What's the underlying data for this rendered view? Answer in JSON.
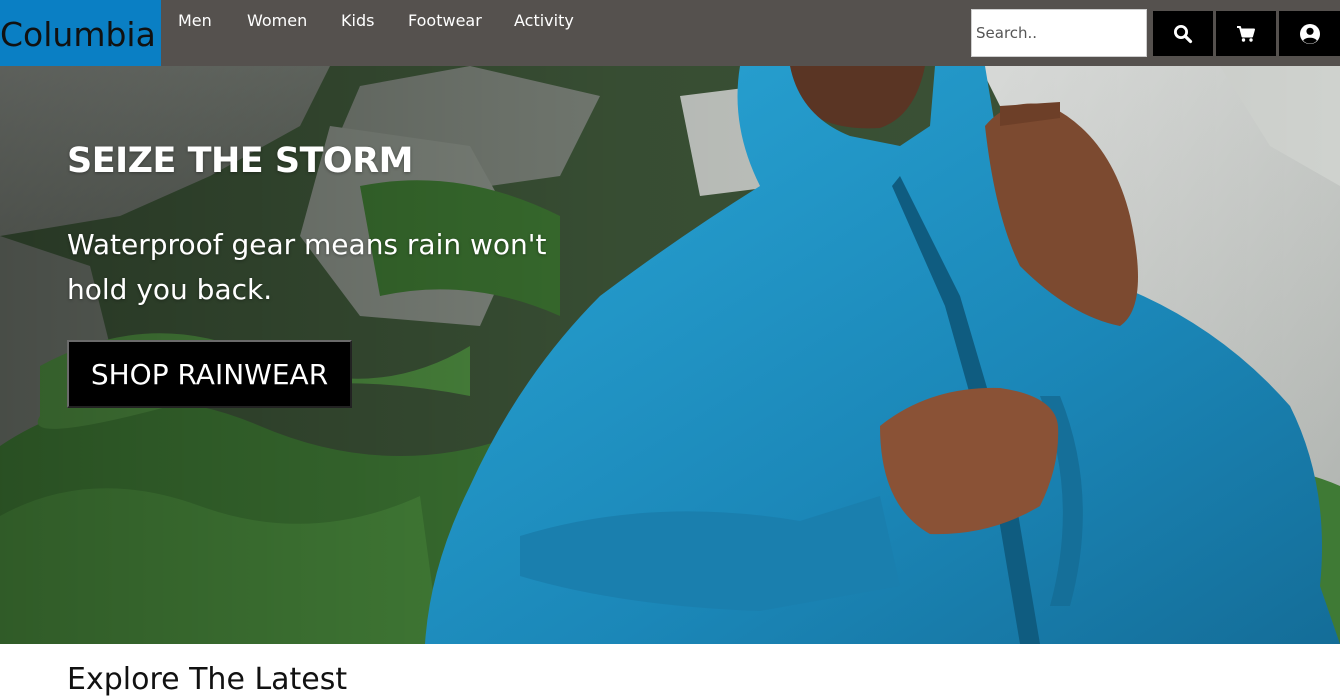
{
  "header": {
    "logo_text": "Columbia",
    "nav": [
      {
        "label": "Men"
      },
      {
        "label": "Women"
      },
      {
        "label": "Kids"
      },
      {
        "label": "Footwear"
      },
      {
        "label": "Activity"
      }
    ],
    "search": {
      "placeholder": "Search..",
      "value": ""
    },
    "icons": {
      "search": "search-icon",
      "cart": "cart-icon",
      "account": "user-circle-icon"
    },
    "colors": {
      "bar": "#55514e",
      "logo_bg": "#0a7fc4",
      "icon_button": "#000000"
    }
  },
  "hero": {
    "title": "SEIZE THE STORM",
    "subtitle": "Waterproof gear means rain won't hold you back.",
    "cta_label": "SHOP RAINWEAR",
    "image_subject": "person zipping a blue rain jacket among ferns and boulders",
    "colors": {
      "jacket": "#1f8fbf",
      "foliage": "#3f7a35",
      "cta_bg": "#000000"
    }
  },
  "section": {
    "title": "Explore The Latest"
  }
}
